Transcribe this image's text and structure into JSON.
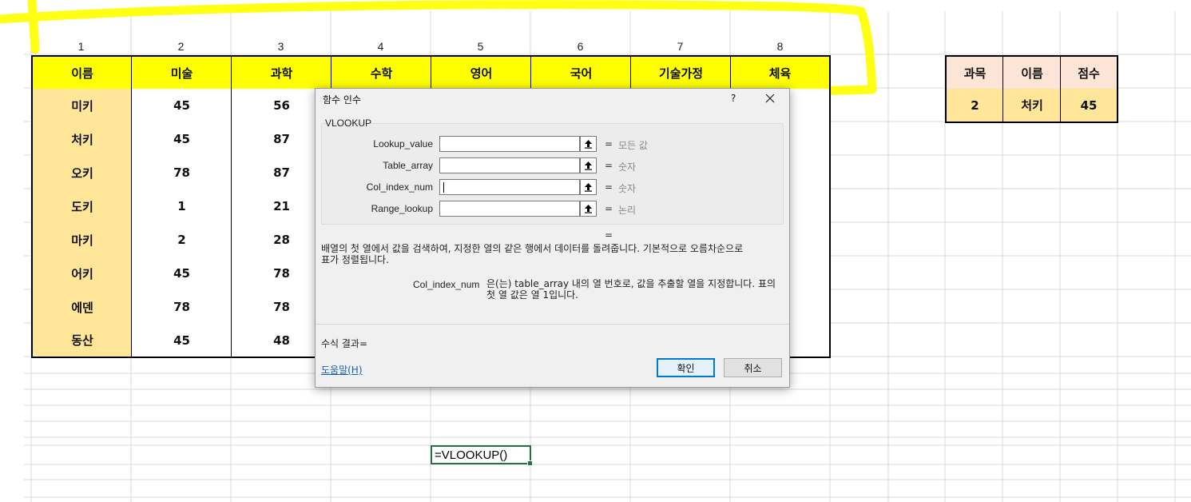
{
  "column_numbers": [
    "1",
    "2",
    "3",
    "4",
    "5",
    "6",
    "7",
    "8"
  ],
  "main_table": {
    "headers": [
      "이름",
      "미술",
      "과학",
      "수학",
      "영어",
      "국어",
      "기술가정",
      "체육"
    ],
    "rows": [
      [
        "미키",
        "45",
        "56"
      ],
      [
        "처키",
        "45",
        "87"
      ],
      [
        "오키",
        "78",
        "87"
      ],
      [
        "도키",
        "1",
        "21"
      ],
      [
        "마키",
        "2",
        "28"
      ],
      [
        "어키",
        "45",
        "78"
      ],
      [
        "에덴",
        "78",
        "78"
      ],
      [
        "동산",
        "45",
        "48"
      ]
    ]
  },
  "lookup_table": {
    "headers": [
      "과목",
      "이름",
      "점수"
    ],
    "row": [
      "2",
      "처키",
      "45"
    ]
  },
  "active_cell": {
    "formula": "=VLOOKUP()"
  },
  "dialog": {
    "title": "함수 인수",
    "help_glyph": "?",
    "function_name": "VLOOKUP",
    "args": [
      {
        "label": "Lookup_value",
        "value": "",
        "hint": "모든 값"
      },
      {
        "label": "Table_array",
        "value": "",
        "hint": "숫자"
      },
      {
        "label": "Col_index_num",
        "value": "",
        "hint": "숫자"
      },
      {
        "label": "Range_lookup",
        "value": "",
        "hint": "논리"
      }
    ],
    "equals": "=",
    "description_line1": "배열의 첫 열에서 값을 검색하여, 지정한 열의 같은 행에서 데이터를 돌려줍니다. 기본적으로 오름차순으로",
    "description_line2": "표가 정렬됩니다.",
    "arg_desc_name": "Col_index_num",
    "arg_desc_line1": "은(는) table_array 내의 열 번호로, 값을 추출할 열을 지정합니다. 표의",
    "arg_desc_line2": "첫 열 값은 열 1입니다.",
    "result_label": "수식 결과=",
    "help_link": "도움말(H)",
    "ok_label": "확인",
    "cancel_label": "취소"
  },
  "colors": {
    "header_yellow": "#ffff00",
    "name_col_fill": "#ffe699",
    "lookup_header_fill": "#fce4d6",
    "lookup_row_fill": "#ffe699",
    "highlighter": "#ffff00",
    "cell_border": "#000000",
    "gridline": "#d9d9d9",
    "active_cell_border": "#217346"
  }
}
